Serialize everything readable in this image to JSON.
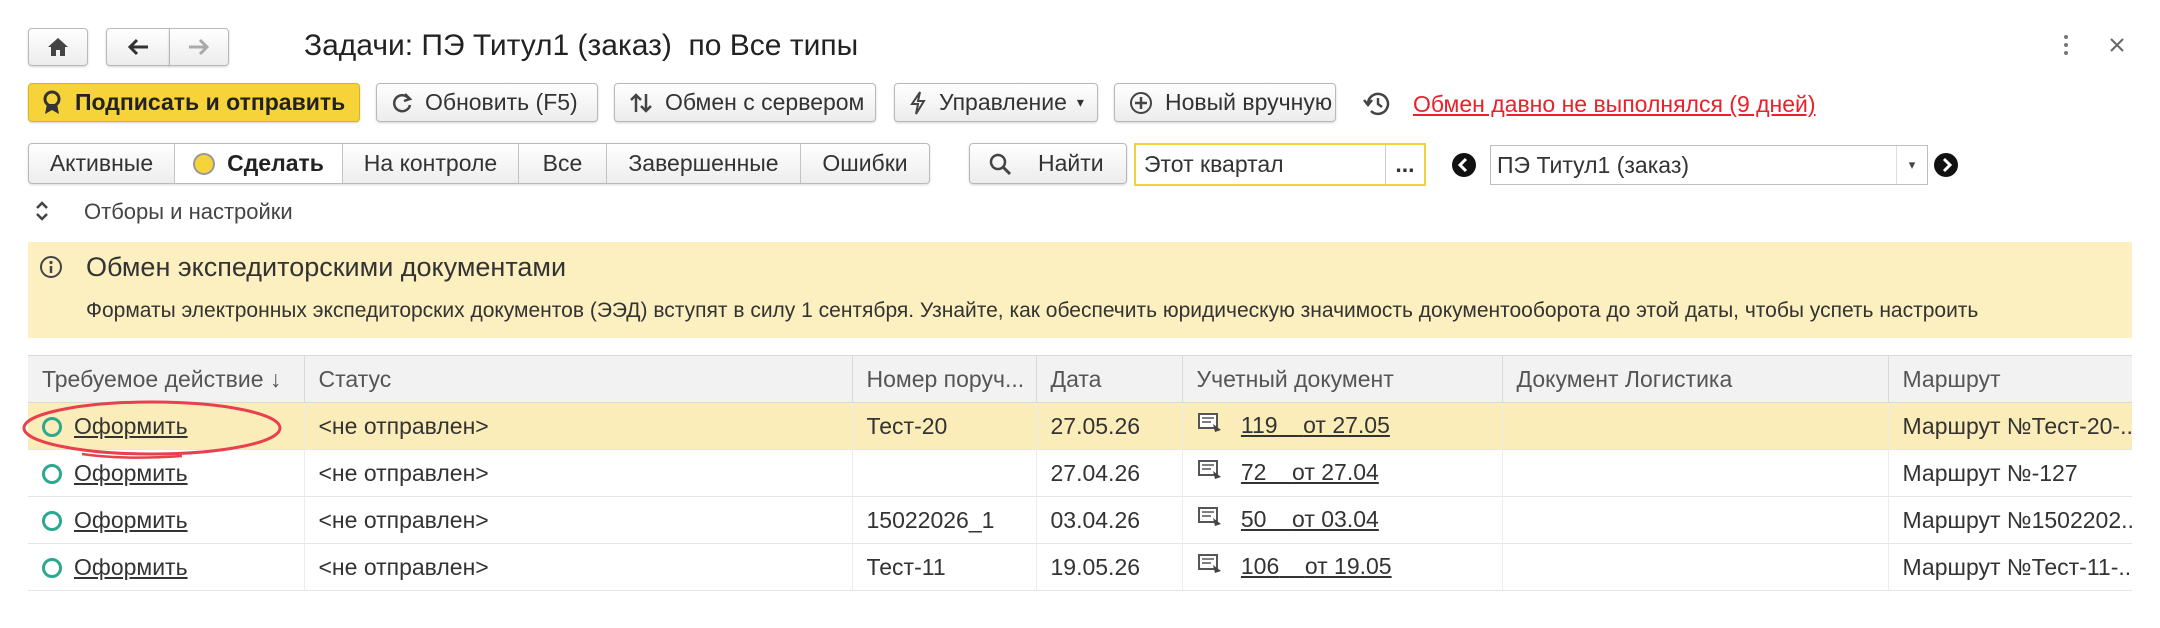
{
  "window": {
    "title": "Задачи: ПЭ Титул1 (заказ)  по Все типы",
    "more_icon": "more-vertical-icon",
    "close_icon": "close-icon"
  },
  "nav": {
    "home_icon": "home-icon",
    "back_icon": "arrow-left-icon",
    "forward_icon": "arrow-right-icon"
  },
  "toolbar": {
    "sign_send": "Подписать и отправить",
    "refresh": "Обновить (F5)",
    "exchange": "Обмен с сервером",
    "manage": "Управление",
    "new_manual": "Новый вручную",
    "warning_link": "Обмен давно не выполнялся (9 дней)"
  },
  "filters": {
    "tabs": [
      "Активные",
      "Сделать",
      "На контроле",
      "Все",
      "Завершенные",
      "Ошибки"
    ],
    "active_tab": "Сделать",
    "find": "Найти",
    "period": "Этот квартал",
    "period_button": "...",
    "org": "ПЭ Титул1 (заказ)"
  },
  "settings": {
    "label": "Отборы и настройки"
  },
  "banner": {
    "title": "Обмен экспедиторскими документами",
    "text": "Форматы электронных экспедиторских документов (ЭЭД) вступят в силу 1 сентября. Узнайте, как обеспечить юридическую значимость документооборота до этой даты, чтобы успеть настроить"
  },
  "table": {
    "columns": [
      "Требуемое действие",
      "Статус",
      "Номер поруч...",
      "Дата",
      "Учетный документ",
      "Документ Логистика",
      "Маршрут"
    ],
    "sort_indicator": "↓",
    "rows": [
      {
        "action": "Оформить",
        "status": "<не отправлен>",
        "number": "Тест-20",
        "date": "27.05.26",
        "doc_num": "119",
        "doc_date": "от 27.05",
        "logistics": "",
        "route": "Маршрут №Тест-20-..."
      },
      {
        "action": "Оформить",
        "status": "<не отправлен>",
        "number": "",
        "date": "27.04.26",
        "doc_num": "72",
        "doc_date": "от 27.04",
        "logistics": "",
        "route": "Маршрут №-127"
      },
      {
        "action": "Оформить",
        "status": "<не отправлен>",
        "number": "15022026_1",
        "date": "03.04.26",
        "doc_num": "50",
        "doc_date": "от 03.04",
        "logistics": "",
        "route": "Маршрут №1502202..."
      },
      {
        "action": "Оформить",
        "status": "<не отправлен>",
        "number": "Тест-11",
        "date": "19.05.26",
        "doc_num": "106",
        "doc_date": "от 19.05",
        "logistics": "",
        "route": "Маршрут №Тест-11-..."
      }
    ]
  },
  "colors": {
    "accent_yellow": "#f7d33a",
    "warning_red": "#e8212b",
    "selected_row": "#fbedb9",
    "banner_bg": "#fcf0c0",
    "status_circle": "#2ca88e",
    "highlight_ellipse": "#e8404c"
  }
}
